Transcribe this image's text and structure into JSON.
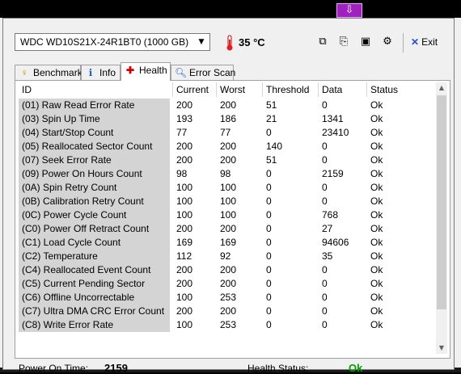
{
  "drive": {
    "label": "WDC    WD10S21X-24R1BT0 (1000 GB)"
  },
  "temperature": "35 °C",
  "toolbar": {
    "exit_label": "Exit"
  },
  "tabs": [
    {
      "label": "Benchmark",
      "icon": "benchmark-icon"
    },
    {
      "label": "Info",
      "icon": "info-icon"
    },
    {
      "label": "Health",
      "icon": "health-cross-icon",
      "active": true
    },
    {
      "label": "Error Scan",
      "icon": "magnifier-icon"
    }
  ],
  "table": {
    "headers": [
      "ID",
      "Current",
      "Worst",
      "Threshold",
      "Data",
      "Status"
    ],
    "rows": [
      [
        "(01) Raw Read Error Rate",
        "200",
        "200",
        "51",
        "0",
        "Ok"
      ],
      [
        "(03) Spin Up Time",
        "193",
        "186",
        "21",
        "1341",
        "Ok"
      ],
      [
        "(04) Start/Stop Count",
        "77",
        "77",
        "0",
        "23410",
        "Ok"
      ],
      [
        "(05) Reallocated Sector Count",
        "200",
        "200",
        "140",
        "0",
        "Ok"
      ],
      [
        "(07) Seek Error Rate",
        "200",
        "200",
        "51",
        "0",
        "Ok"
      ],
      [
        "(09) Power On Hours Count",
        "98",
        "98",
        "0",
        "2159",
        "Ok"
      ],
      [
        "(0A) Spin Retry Count",
        "100",
        "100",
        "0",
        "0",
        "Ok"
      ],
      [
        "(0B) Calibration Retry Count",
        "100",
        "100",
        "0",
        "0",
        "Ok"
      ],
      [
        "(0C) Power Cycle Count",
        "100",
        "100",
        "0",
        "768",
        "Ok"
      ],
      [
        "(C0) Power Off Retract Count",
        "200",
        "200",
        "0",
        "27",
        "Ok"
      ],
      [
        "(C1) Load Cycle Count",
        "169",
        "169",
        "0",
        "94606",
        "Ok"
      ],
      [
        "(C2) Temperature",
        "112",
        "92",
        "0",
        "35",
        "Ok"
      ],
      [
        "(C4) Reallocated Event Count",
        "200",
        "200",
        "0",
        "0",
        "Ok"
      ],
      [
        "(C5) Current Pending Sector",
        "200",
        "200",
        "0",
        "0",
        "Ok"
      ],
      [
        "(C6) Offline Uncorrectable",
        "100",
        "253",
        "0",
        "0",
        "Ok"
      ],
      [
        "(C7) Ultra DMA CRC Error Count",
        "200",
        "200",
        "0",
        "0",
        "Ok"
      ],
      [
        "(C8) Write Error Rate",
        "100",
        "253",
        "0",
        "0",
        "Ok"
      ]
    ]
  },
  "footer": {
    "power_on_label": "Power On Time:",
    "power_on_value": "2159",
    "health_label": "Health Status:",
    "health_value": "Ok",
    "health_color": "#00a000"
  }
}
